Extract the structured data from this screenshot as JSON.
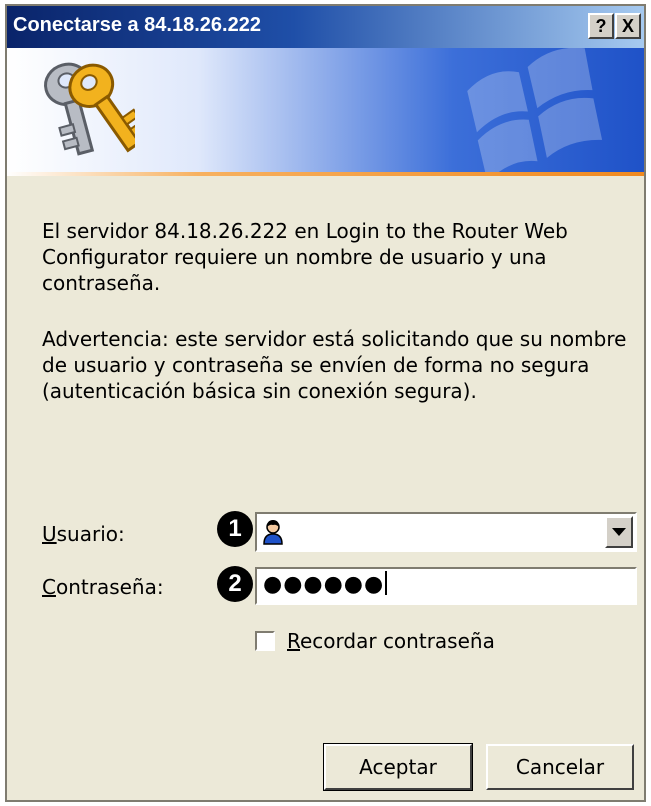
{
  "window": {
    "title": "Conectarse a 84.18.26.222",
    "help_label": "?",
    "close_label": "X"
  },
  "banner": {
    "icon": "keys-icon",
    "watermark_icon": "windows-logo-icon"
  },
  "message": {
    "line1": "El servidor 84.18.26.222 en Login to the Router Web Configurator requiere un nombre de usuario y una contraseña.",
    "warning": "Advertencia: este servidor está solicitando que su nombre de usuario y contraseña se envíen de forma no segura (autenticación básica sin conexión segura)."
  },
  "form": {
    "username": {
      "label_mnemonic": "U",
      "label_rest": "suario:",
      "value": "",
      "icon": "user-icon",
      "callout": "1"
    },
    "password": {
      "label_mnemonic": "C",
      "label_rest": "ontraseña:",
      "masked_value": "●●●●●●",
      "callout": "2"
    },
    "remember": {
      "label_mnemonic": "R",
      "label_rest": "ecordar contraseña",
      "checked": false
    }
  },
  "buttons": {
    "ok": "Aceptar",
    "cancel": "Cancelar"
  }
}
